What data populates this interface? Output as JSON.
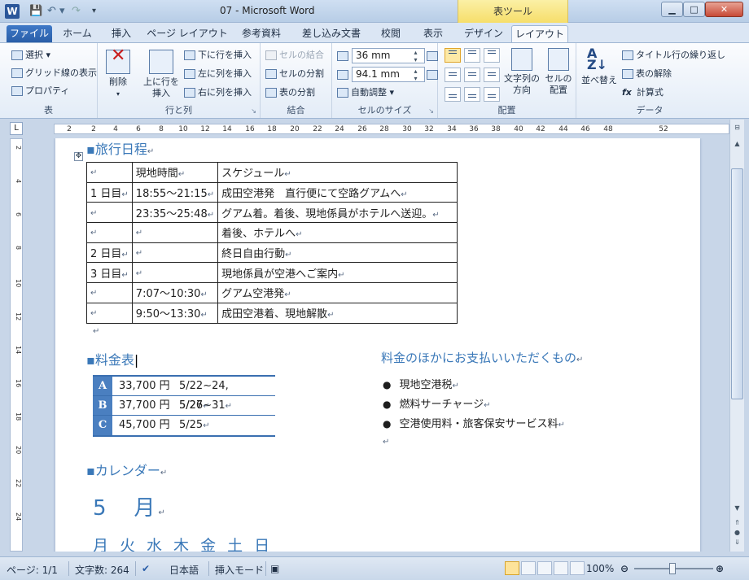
{
  "window": {
    "title": "07 - Microsoft Word",
    "context_tab_header": "表ツール"
  },
  "tabs": {
    "file": "ファイル",
    "home": "ホーム",
    "insert": "挿入",
    "page_layout": "ページ レイアウト",
    "references": "参考資料",
    "mailings": "差し込み文書",
    "review": "校閲",
    "view": "表示",
    "design": "デザイン",
    "layout": "レイアウト"
  },
  "ribbon": {
    "table": {
      "select": "選択",
      "gridlines": "グリッド線の表示",
      "properties": "プロパティ",
      "label": "表"
    },
    "rows_cols": {
      "delete": "削除",
      "insert_above_1": "上に行を",
      "insert_above_2": "挿入",
      "insert_below": "下に行を挿入",
      "insert_left": "左に列を挿入",
      "insert_right": "右に列を挿入",
      "label": "行と列"
    },
    "merge": {
      "merge_cells": "セルの結合",
      "split_cells": "セルの分割",
      "split_table": "表の分割",
      "label": "結合"
    },
    "cell_size": {
      "height": "36 mm",
      "width": "94.1 mm",
      "autofit": "自動調整",
      "label": "セルのサイズ"
    },
    "alignment": {
      "text_direction_1": "文字列の",
      "text_direction_2": "方向",
      "cell_margins_1": "セルの",
      "cell_margins_2": "配置",
      "label": "配置"
    },
    "data": {
      "sort": "並べ替え",
      "repeat_header": "タイトル行の繰り返し",
      "convert_to_text": "表の解除",
      "formula": "計算式",
      "label": "データ"
    }
  },
  "ruler": {
    "h_ticks": [
      "2",
      "2",
      "4",
      "6",
      "8",
      "10",
      "12",
      "14",
      "16",
      "18",
      "20",
      "22",
      "24",
      "26",
      "28",
      "30",
      "32",
      "34",
      "36",
      "38",
      "40",
      "42",
      "44",
      "46",
      "48",
      "52"
    ],
    "v_ticks": [
      "2",
      "4",
      "6",
      "8",
      "10",
      "12",
      "14",
      "16",
      "18",
      "20",
      "22",
      "24"
    ]
  },
  "document": {
    "section_itinerary": "旅行日程",
    "schedule": [
      [
        "",
        "現地時間",
        "スケジュール"
      ],
      [
        "1 日目",
        "18:55～21:15",
        "成田空港発　直行便にて空路グアムへ"
      ],
      [
        "",
        "23:35～25:48",
        "グアム着。着後、現地係員がホテルへ送迎。"
      ],
      [
        "",
        "",
        "着後、ホテルへ"
      ],
      [
        "2 日目",
        "",
        "終日自由行動"
      ],
      [
        "3 日目",
        "",
        "現地係員が空港へご案内"
      ],
      [
        "",
        "7:07～10:30",
        "グアム空港発"
      ],
      [
        "",
        "9:50～13:30",
        "成田空港着、現地解散"
      ]
    ],
    "section_price": "料金表",
    "prices": [
      {
        "key": "A",
        "price": "33,700 円",
        "dates": "5/22~24, 5/27~31"
      },
      {
        "key": "B",
        "price": "37,700 円",
        "dates": "5/26"
      },
      {
        "key": "C",
        "price": "45,700 円",
        "dates": "5/25"
      }
    ],
    "section_extra": "料金のほかにお支払いいただくもの",
    "extra_items": [
      "現地空港税",
      "燃料サーチャージ",
      "空港使用料・旅客保安サービス料"
    ],
    "section_calendar": "カレンダー",
    "month": "5　月",
    "weekdays": [
      "月",
      "火",
      "水",
      "木",
      "金",
      "土",
      "日"
    ]
  },
  "status": {
    "page": "ページ: 1/1",
    "words": "文字数: 264",
    "language": "日本語",
    "mode": "挿入モード",
    "zoom": "100%"
  }
}
